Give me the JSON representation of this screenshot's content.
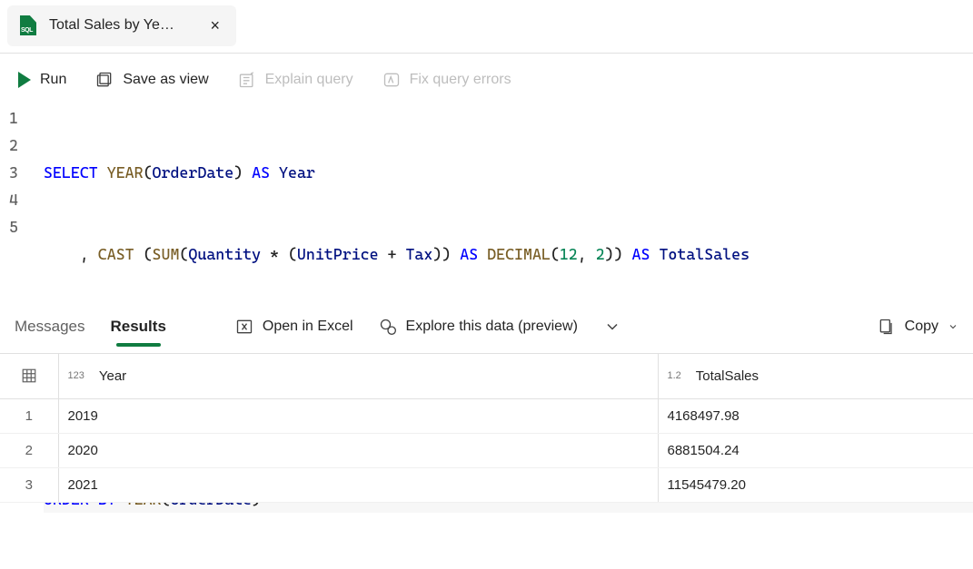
{
  "tab": {
    "title": "Total Sales by Ye…",
    "close_label": "×"
  },
  "toolbar": {
    "run": "Run",
    "save_view": "Save as view",
    "explain": "Explain query",
    "fix_errors": "Fix query errors"
  },
  "sql": {
    "lines": [
      "1",
      "2",
      "3",
      "4",
      "5"
    ]
  },
  "results_toolbar": {
    "messages": "Messages",
    "results": "Results",
    "open_excel": "Open in Excel",
    "explore": "Explore this data (preview)",
    "copy": "Copy"
  },
  "table": {
    "columns": [
      {
        "type": "123",
        "name": "Year"
      },
      {
        "type": "1.2",
        "name": "TotalSales"
      }
    ],
    "rows": [
      {
        "n": "1",
        "year": "2019",
        "total": "4168497.98"
      },
      {
        "n": "2",
        "year": "2020",
        "total": "6881504.24"
      },
      {
        "n": "3",
        "year": "2021",
        "total": "11545479.20"
      }
    ]
  }
}
